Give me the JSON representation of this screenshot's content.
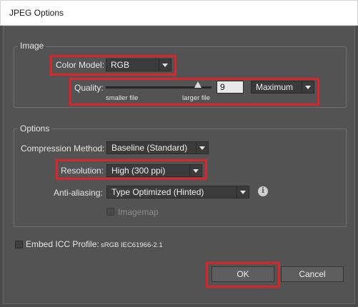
{
  "window": {
    "title": "JPEG Options"
  },
  "image_group": {
    "label": "Image",
    "color_model_label": "Color Model:",
    "color_model_value": "RGB",
    "quality_label": "Quality:",
    "quality_value": "9",
    "quality_preset": "Maximum",
    "smaller_file": "smaller file",
    "larger_file": "larger file"
  },
  "options_group": {
    "label": "Options",
    "compression_label": "Compression Method:",
    "compression_value": "Baseline (Standard)",
    "resolution_label": "Resolution:",
    "resolution_value": "High (300 ppi)",
    "antialias_label": "Anti-aliasing:",
    "antialias_value": "Type Optimized (Hinted)",
    "imagemap_label": "Imagemap"
  },
  "icc": {
    "label": "Embed ICC Profile:",
    "profile": "sRGB IEC61966-2.1"
  },
  "buttons": {
    "ok": "OK",
    "cancel": "Cancel"
  },
  "colors": {
    "highlight": "#d8262c",
    "dialog_bg": "#535353"
  }
}
